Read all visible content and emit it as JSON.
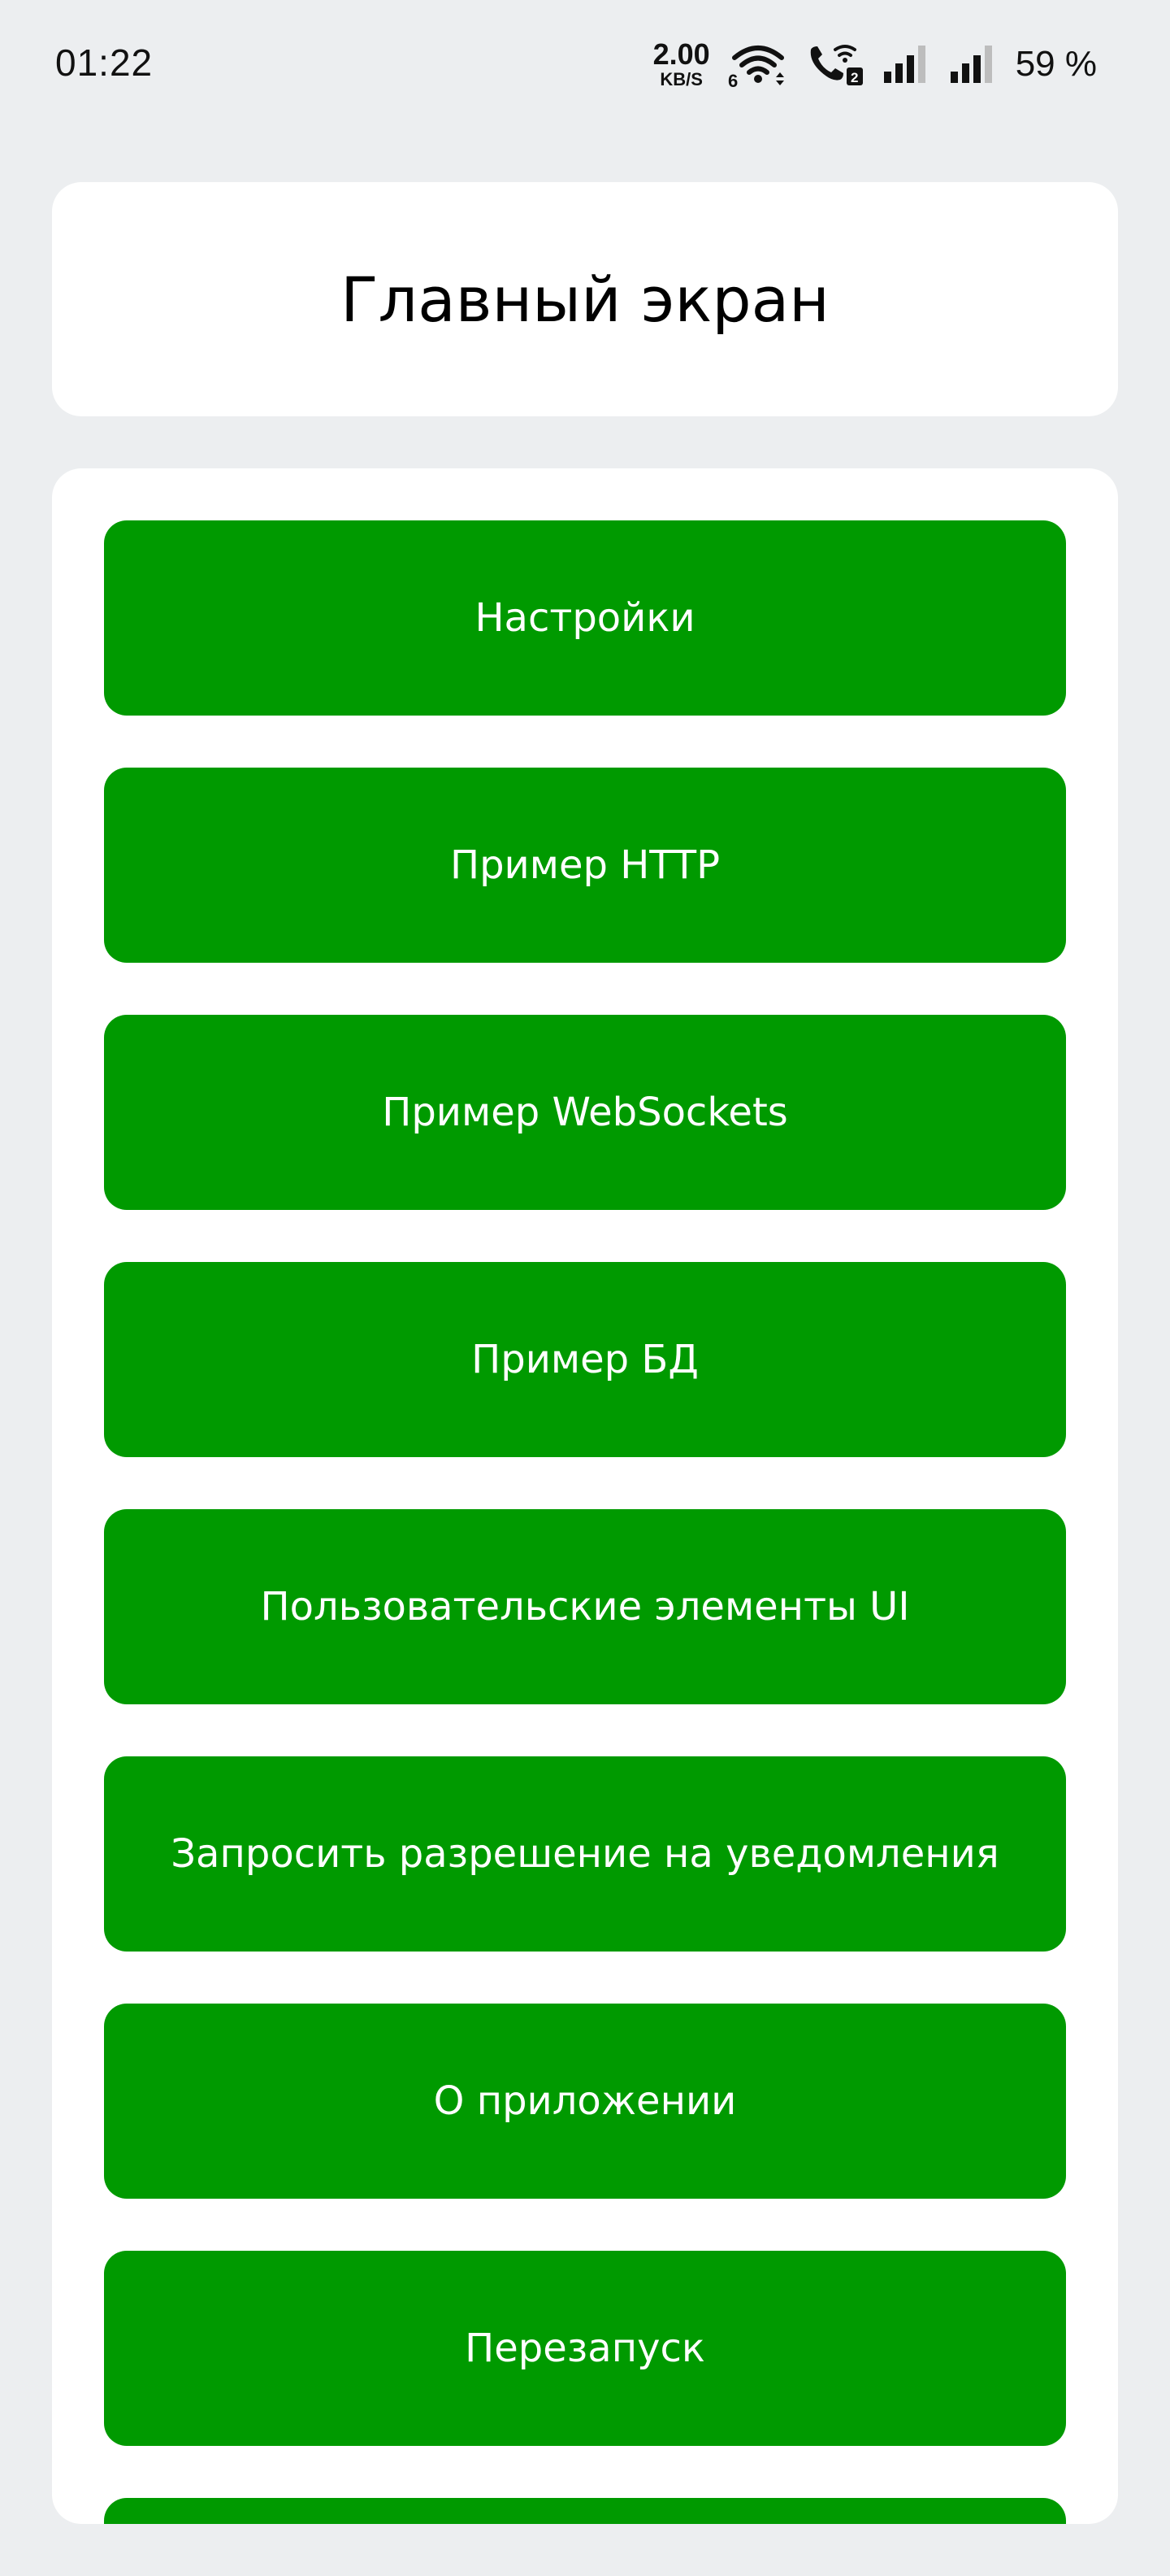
{
  "status_bar": {
    "time": "01:22",
    "net_speed_value": "2.00",
    "net_speed_unit": "KB/S",
    "wifi_badge": "6",
    "call_badge": "2",
    "battery": "59 %"
  },
  "header": {
    "title": "Главный экран"
  },
  "menu": {
    "items": [
      {
        "label": "Настройки"
      },
      {
        "label": "Пример HTTP"
      },
      {
        "label": "Пример WebSockets"
      },
      {
        "label": "Пример БД"
      },
      {
        "label": "Пользовательские элементы UI"
      },
      {
        "label": "Запросить разрешение на уведомления"
      },
      {
        "label": "О приложении"
      },
      {
        "label": "Перезапуск"
      }
    ]
  },
  "colors": {
    "background": "#eceef0",
    "card": "#ffffff",
    "button": "#009a00",
    "button_text": "#ffffff"
  }
}
